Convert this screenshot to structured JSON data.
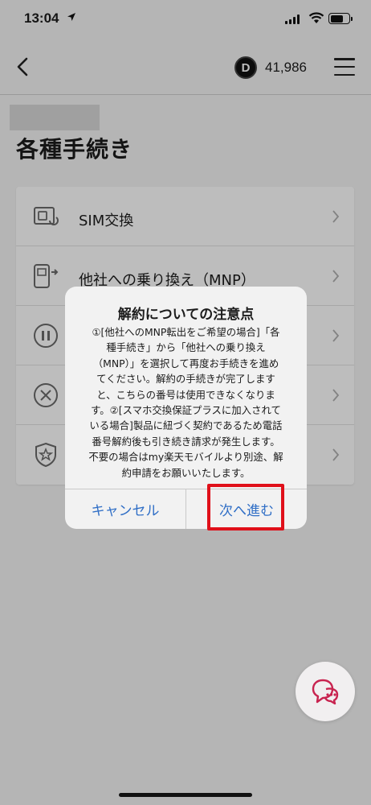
{
  "status_bar": {
    "time": "13:04"
  },
  "header": {
    "points_badge": "D",
    "points": "41,986"
  },
  "page": {
    "title": "各種手続き"
  },
  "list": {
    "items": [
      {
        "label": "SIM交換",
        "icon": "sim-card-icon"
      },
      {
        "label": "他社への乗り換え（MNP）",
        "icon": "phone-transfer-icon"
      },
      {
        "label": "",
        "icon": "pause-icon"
      },
      {
        "label": "",
        "icon": "cancel-x-icon"
      },
      {
        "label": "",
        "icon": "shield-star-icon"
      }
    ]
  },
  "dialog": {
    "title": "解約についての注意点",
    "body_lines": [
      "①[他社へのMNP転出をご希望の場合]「各",
      "種手続き」から「他社への乗り換え",
      "（MNP）」を選択して再度お手続きを進め",
      "てください。解約の手続きが完了します",
      "と、こちらの番号は使用できなくなりま",
      "す。②[スマホ交換保証プラスに加入されて",
      "いる場合]製品に紐づく契約であるため電話",
      "番号解約後も引き続き請求が発生します。",
      "不要の場合はmy楽天モバイルより別途、解",
      "約申請をお願いいたします。"
    ],
    "cancel_label": "キャンセル",
    "next_label": "次へ進む"
  },
  "colors": {
    "accent_link": "#2f6ec6",
    "highlight_box": "#e0101a",
    "chat_icon": "#c8234f"
  }
}
